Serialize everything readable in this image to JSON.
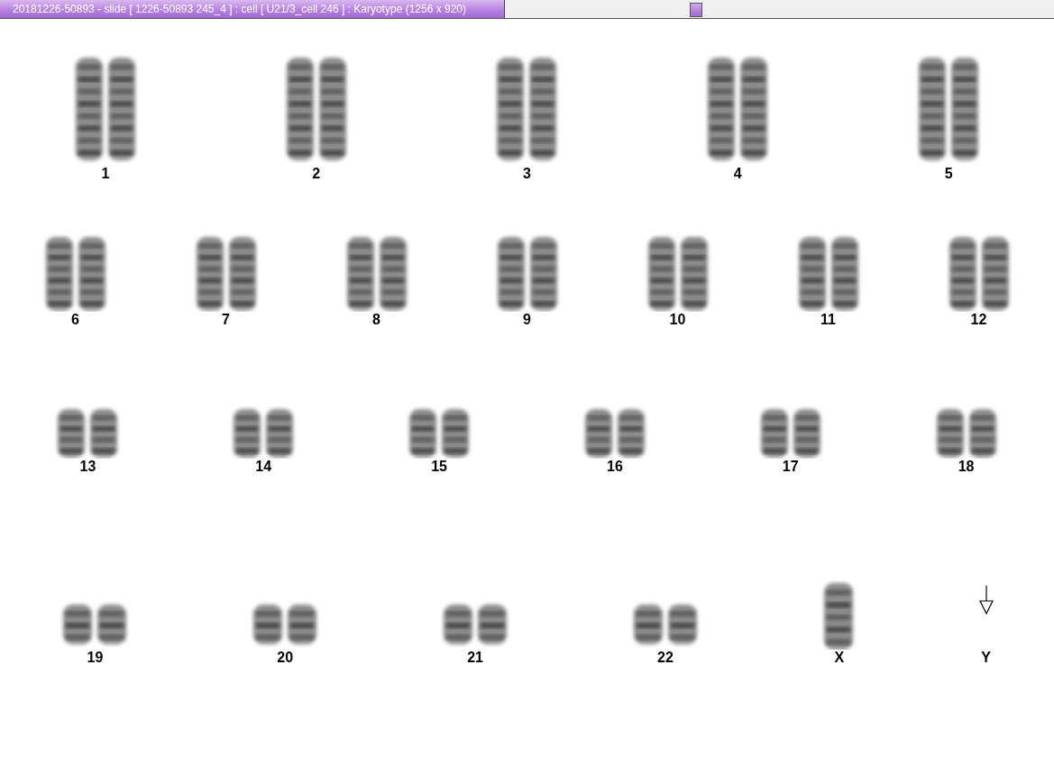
{
  "window": {
    "title": "20181226-50893 - slide [ 1226-50893 245_4 ] : cell [ U21/3_cell 246 ] : Karyotype  (1256 x 920)"
  },
  "karyotype": {
    "rows": [
      [
        {
          "label": "1",
          "kind": "pair"
        },
        {
          "label": "2",
          "kind": "pair"
        },
        {
          "label": "3",
          "kind": "pair"
        },
        {
          "label": "4",
          "kind": "pair"
        },
        {
          "label": "5",
          "kind": "pair"
        }
      ],
      [
        {
          "label": "6",
          "kind": "pair"
        },
        {
          "label": "7",
          "kind": "pair"
        },
        {
          "label": "8",
          "kind": "pair"
        },
        {
          "label": "9",
          "kind": "pair"
        },
        {
          "label": "10",
          "kind": "pair"
        },
        {
          "label": "11",
          "kind": "pair"
        },
        {
          "label": "12",
          "kind": "pair"
        }
      ],
      [
        {
          "label": "13",
          "kind": "pair"
        },
        {
          "label": "14",
          "kind": "pair"
        },
        {
          "label": "15",
          "kind": "pair"
        },
        {
          "label": "16",
          "kind": "pair"
        },
        {
          "label": "17",
          "kind": "pair"
        },
        {
          "label": "18",
          "kind": "pair"
        }
      ],
      [
        {
          "label": "19",
          "kind": "pair"
        },
        {
          "label": "20",
          "kind": "pair"
        },
        {
          "label": "21",
          "kind": "pair"
        },
        {
          "label": "22",
          "kind": "pair"
        },
        {
          "label": "X",
          "kind": "single"
        },
        {
          "label": "Y",
          "kind": "missing"
        }
      ]
    ]
  }
}
